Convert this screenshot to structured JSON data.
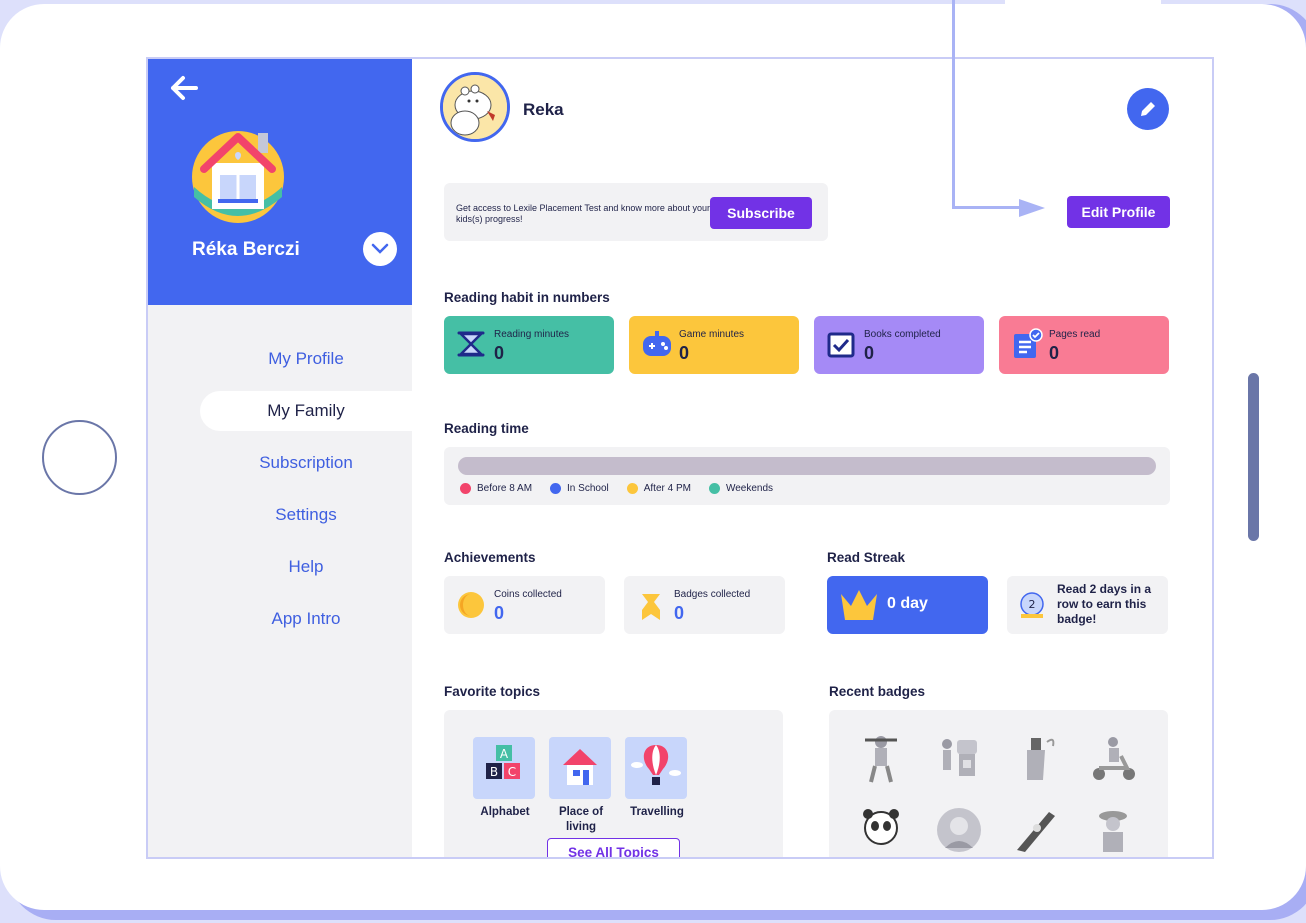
{
  "colors": {
    "primary_blue": "#4267ef",
    "purple": "#7232e6",
    "teal": "#45bfa5",
    "yellow": "#fcc63c",
    "lavender": "#a58af6",
    "pink": "#f97b94"
  },
  "sidebar": {
    "user_name": "Réka Berczi",
    "nav": [
      {
        "label": "My Profile"
      },
      {
        "label": "My Family"
      },
      {
        "label": "Subscription"
      },
      {
        "label": "Settings"
      },
      {
        "label": "Help"
      },
      {
        "label": "App Intro"
      }
    ]
  },
  "profile": {
    "child_name": "Reka",
    "edit_button": "Edit Profile"
  },
  "promo": {
    "text": "Get access to Lexile Placement Test and know more about your kids(s) progress!",
    "button": "Subscribe"
  },
  "habit": {
    "title": "Reading habit in numbers",
    "stats": [
      {
        "label": "Reading minutes",
        "value": "0",
        "icon": "hourglass-icon"
      },
      {
        "label": "Game minutes",
        "value": "0",
        "icon": "gamepad-icon"
      },
      {
        "label": "Books completed",
        "value": "0",
        "icon": "checkbox-icon"
      },
      {
        "label": "Pages read",
        "value": "0",
        "icon": "document-check-icon"
      }
    ]
  },
  "reading_time": {
    "title": "Reading time",
    "legend": [
      {
        "label": "Before 8 AM",
        "color": "#f2446b"
      },
      {
        "label": "In School",
        "color": "#4267ef"
      },
      {
        "label": "After 4 PM",
        "color": "#fcc63c"
      },
      {
        "label": "Weekends",
        "color": "#45bfa5"
      }
    ]
  },
  "achievements": {
    "title": "Achievements",
    "items": [
      {
        "label": "Coins collected",
        "value": "0"
      },
      {
        "label": "Badges collected",
        "value": "0"
      }
    ]
  },
  "streak": {
    "title": "Read Streak",
    "value": "0 day",
    "badge_number": "2",
    "hint": "Read 2 days in a row to earn this badge!"
  },
  "topics": {
    "title": "Favorite topics",
    "items": [
      {
        "label": "Alphabet"
      },
      {
        "label": "Place of living"
      },
      {
        "label": "Travelling"
      }
    ],
    "see_all": "See All Topics",
    "alphabet_letters": [
      "A",
      "B",
      "C"
    ]
  },
  "badges": {
    "title": "Recent badges"
  }
}
